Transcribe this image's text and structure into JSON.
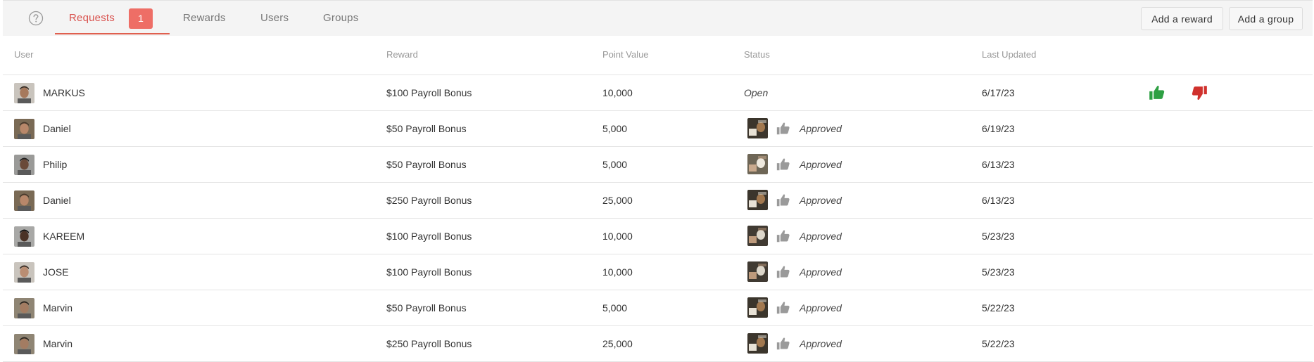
{
  "tabs": [
    {
      "label": "Requests",
      "badge": "1",
      "active": true
    },
    {
      "label": "Rewards"
    },
    {
      "label": "Users"
    },
    {
      "label": "Groups"
    }
  ],
  "actions": {
    "add_reward": "Add a reward",
    "add_group": "Add a group"
  },
  "columns": [
    "User",
    "Reward",
    "Point Value",
    "Status",
    "Last Updated"
  ],
  "rows": [
    {
      "user": "MARKUS",
      "reward": "$100 Payroll Bonus",
      "points": "10,000",
      "status": "Open",
      "updated": "6/17/23"
    },
    {
      "user": "Daniel",
      "reward": "$50 Payroll Bonus",
      "points": "5,000",
      "status": "Approved",
      "updated": "6/19/23"
    },
    {
      "user": "Philip",
      "reward": "$50 Payroll Bonus",
      "points": "5,000",
      "status": "Approved",
      "updated": "6/13/23"
    },
    {
      "user": "Daniel",
      "reward": "$250 Payroll Bonus",
      "points": "25,000",
      "status": "Approved",
      "updated": "6/13/23"
    },
    {
      "user": "KAREEM",
      "reward": "$100 Payroll Bonus",
      "points": "10,000",
      "status": "Approved",
      "updated": "5/23/23"
    },
    {
      "user": "JOSE",
      "reward": "$100 Payroll Bonus",
      "points": "10,000",
      "status": "Approved",
      "updated": "5/23/23"
    },
    {
      "user": "Marvin",
      "reward": "$50 Payroll Bonus",
      "points": "5,000",
      "status": "Approved",
      "updated": "5/22/23"
    },
    {
      "user": "Marvin",
      "reward": "$250 Payroll Bonus",
      "points": "25,000",
      "status": "Approved",
      "updated": "5/22/23"
    }
  ],
  "colors": {
    "accent": "#d9534f",
    "badge": "#ee6e66",
    "approve": "#2ea043",
    "reject": "#d0312d",
    "muted_icon": "#9a9a9a"
  },
  "icons": {
    "help": "question-circle-icon",
    "approve": "thumbs-up-icon",
    "reject": "thumbs-down-icon",
    "approved": "thumbs-up-icon"
  }
}
